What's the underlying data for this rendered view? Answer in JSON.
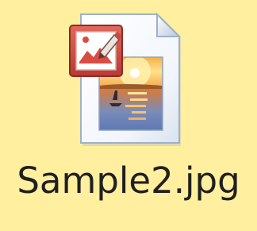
{
  "desktop": {
    "background_color": "#ffef9e",
    "selected_file": {
      "name": "Sample2.jpg",
      "icon": "jpeg-image-file-icon",
      "editor_badge_icon": "paint-editor-badge-icon",
      "badge_color": "#c8463c"
    }
  }
}
